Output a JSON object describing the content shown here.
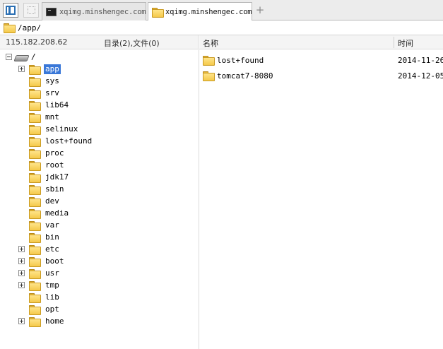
{
  "tabs": [
    {
      "label": "xqimg.minshengec.com",
      "icon": "terminal-icon",
      "active": false
    },
    {
      "label": "xqimg.minshengec.com",
      "icon": "folder-icon",
      "active": true
    }
  ],
  "add_tab_label": "+",
  "path": "/app/",
  "left_header": {
    "ip": "115.182.208.62",
    "count": "目录(2),文件(0)"
  },
  "right_header": {
    "name_col": "名称",
    "time_col": "时间"
  },
  "tree": {
    "root_label": "/",
    "items": [
      {
        "label": "app",
        "expander": "plus",
        "selected": true
      },
      {
        "label": "sys",
        "expander": "none",
        "selected": false
      },
      {
        "label": "srv",
        "expander": "none",
        "selected": false
      },
      {
        "label": "lib64",
        "expander": "none",
        "selected": false
      },
      {
        "label": "mnt",
        "expander": "none",
        "selected": false
      },
      {
        "label": "selinux",
        "expander": "none",
        "selected": false
      },
      {
        "label": "lost+found",
        "expander": "none",
        "selected": false
      },
      {
        "label": "proc",
        "expander": "none",
        "selected": false
      },
      {
        "label": "root",
        "expander": "none",
        "selected": false
      },
      {
        "label": "jdk17",
        "expander": "none",
        "selected": false
      },
      {
        "label": "sbin",
        "expander": "none",
        "selected": false
      },
      {
        "label": "dev",
        "expander": "none",
        "selected": false
      },
      {
        "label": "media",
        "expander": "none",
        "selected": false
      },
      {
        "label": "var",
        "expander": "none",
        "selected": false
      },
      {
        "label": "bin",
        "expander": "none",
        "selected": false
      },
      {
        "label": "etc",
        "expander": "plus",
        "selected": false
      },
      {
        "label": "boot",
        "expander": "plus",
        "selected": false
      },
      {
        "label": "usr",
        "expander": "plus",
        "selected": false
      },
      {
        "label": "tmp",
        "expander": "plus",
        "selected": false
      },
      {
        "label": "lib",
        "expander": "none",
        "selected": false
      },
      {
        "label": "opt",
        "expander": "none",
        "selected": false
      },
      {
        "label": "home",
        "expander": "plus",
        "selected": false
      }
    ]
  },
  "files": [
    {
      "name": "lost+found",
      "time": "2014-11-26"
    },
    {
      "name": "tomcat7-8080",
      "time": "2014-12-05"
    }
  ],
  "colors": {
    "selection": "#3a78d8",
    "folder": "#f5c94a",
    "panel_icon": "#2b6fb3"
  }
}
